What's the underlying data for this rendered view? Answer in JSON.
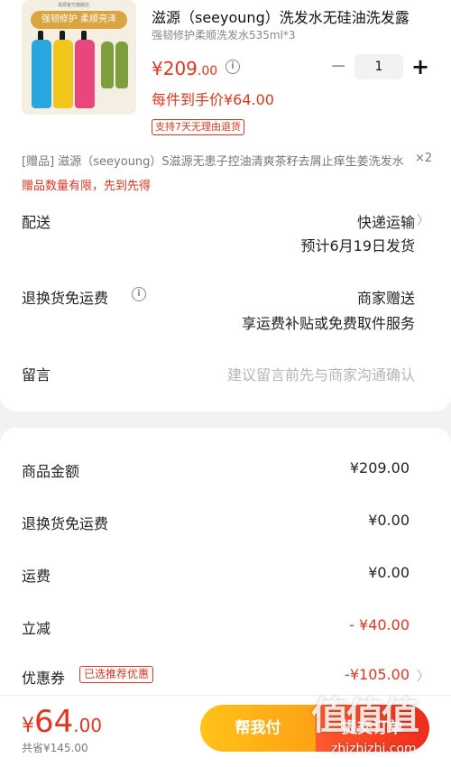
{
  "product": {
    "title": "滋源（seeyoung）洗发水无硅油洗发露",
    "spec": "强韧修护柔顺洗发水535ml*3",
    "price_symbol": "¥",
    "price_int": "209",
    "price_dec": ".00",
    "quantity": "1",
    "daily_price": "每件到手价¥64.00",
    "refund_tag": "支持7天无理由退货",
    "image": {
      "banner": "强韧修护 柔顺亮泽",
      "topline": "滋源官方旗舰店",
      "colors": [
        "#27a6e0",
        "#f2c61d",
        "#e8467c",
        "#7f9e3e"
      ]
    }
  },
  "gift": {
    "text": "[赠品]  滋源（seeyoung）S滋源无患子控油清爽茶籽去屑止痒生姜洗发水",
    "count": "×2",
    "note": "赠品数量有限，先到先得"
  },
  "delivery": {
    "label": "配送",
    "method": "快递运输",
    "date": "预计6月19日发货"
  },
  "return_shipping": {
    "label": "退换货免运费",
    "value": "商家赠送",
    "desc": "享运费补贴或免费取件服务"
  },
  "message": {
    "label": "留言",
    "placeholder": "建议留言前先与商家沟通确认"
  },
  "summary": {
    "goods_label": "商品金额",
    "goods_value": "¥209.00",
    "return_label": "退换货免运费",
    "return_value": "¥0.00",
    "shipping_label": "运费",
    "shipping_value": "¥0.00",
    "discount_label": "立减",
    "discount_value": "- ¥40.00",
    "coupon_label": "优惠券",
    "coupon_tag": "已选推荐优惠",
    "coupon_value": "-¥105.00"
  },
  "footer": {
    "symbol": "¥",
    "total_int": "64",
    "total_dec": ".00",
    "original": "共省¥145.00",
    "help_label": "帮我付",
    "pay_label": "提交订单"
  },
  "watermark": {
    "glyphs": "值值值",
    "url": "zhizhizhi.com"
  },
  "colors": {
    "accent_red": "#e8341c",
    "help_yellow": "#ffa114"
  }
}
